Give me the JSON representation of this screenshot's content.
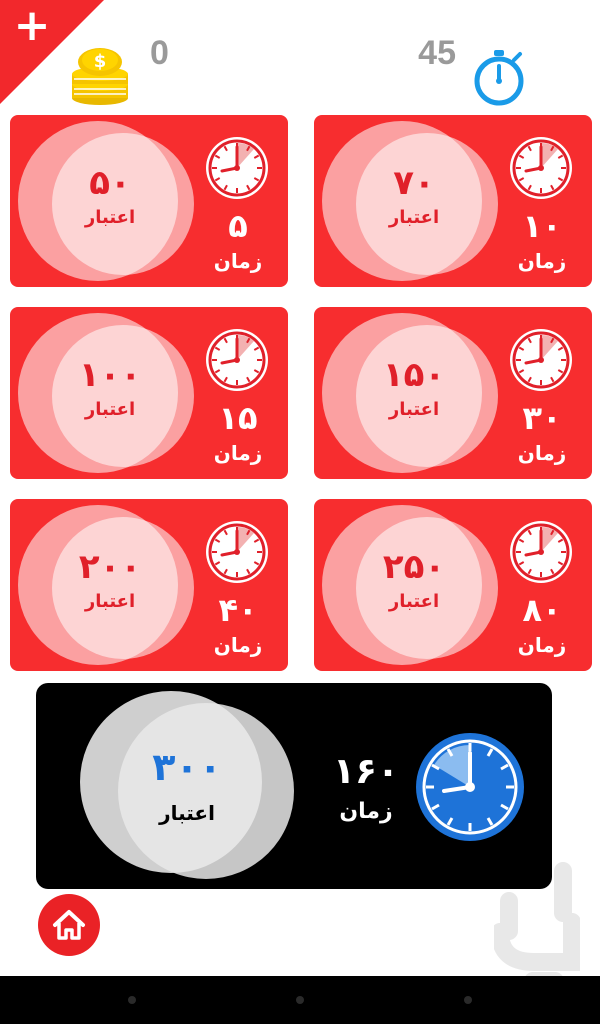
{
  "header": {
    "coins": "0",
    "time": "45",
    "add_icon": "plus-icon",
    "coin_icon": "coins-icon",
    "timer_icon": "stopwatch-icon"
  },
  "packages": [
    {
      "credit": "۵۰",
      "credit_label": "اعتبار",
      "time": "۵",
      "time_label": "زمان"
    },
    {
      "credit": "۷۰",
      "credit_label": "اعتبار",
      "time": "۱۰",
      "time_label": "زمان"
    },
    {
      "credit": "۱۰۰",
      "credit_label": "اعتبار",
      "time": "۱۵",
      "time_label": "زمان"
    },
    {
      "credit": "۱۵۰",
      "credit_label": "اعتبار",
      "time": "۳۰",
      "time_label": "زمان"
    },
    {
      "credit": "۲۰۰",
      "credit_label": "اعتبار",
      "time": "۴۰",
      "time_label": "زمان"
    },
    {
      "credit": "۲۵۰",
      "credit_label": "اعتبار",
      "time": "۸۰",
      "time_label": "زمان"
    }
  ],
  "featured": {
    "credit": "۳۰۰",
    "credit_label": "اعتبار",
    "time": "۱۶۰",
    "time_label": "زمان"
  },
  "colors": {
    "card_red": "#f72d2f",
    "accent_blue": "#1e73d8",
    "featured_bg": "#000000"
  },
  "footer": {
    "home_icon": "home-icon",
    "watermark_icon": "bazaar-logo-icon"
  }
}
